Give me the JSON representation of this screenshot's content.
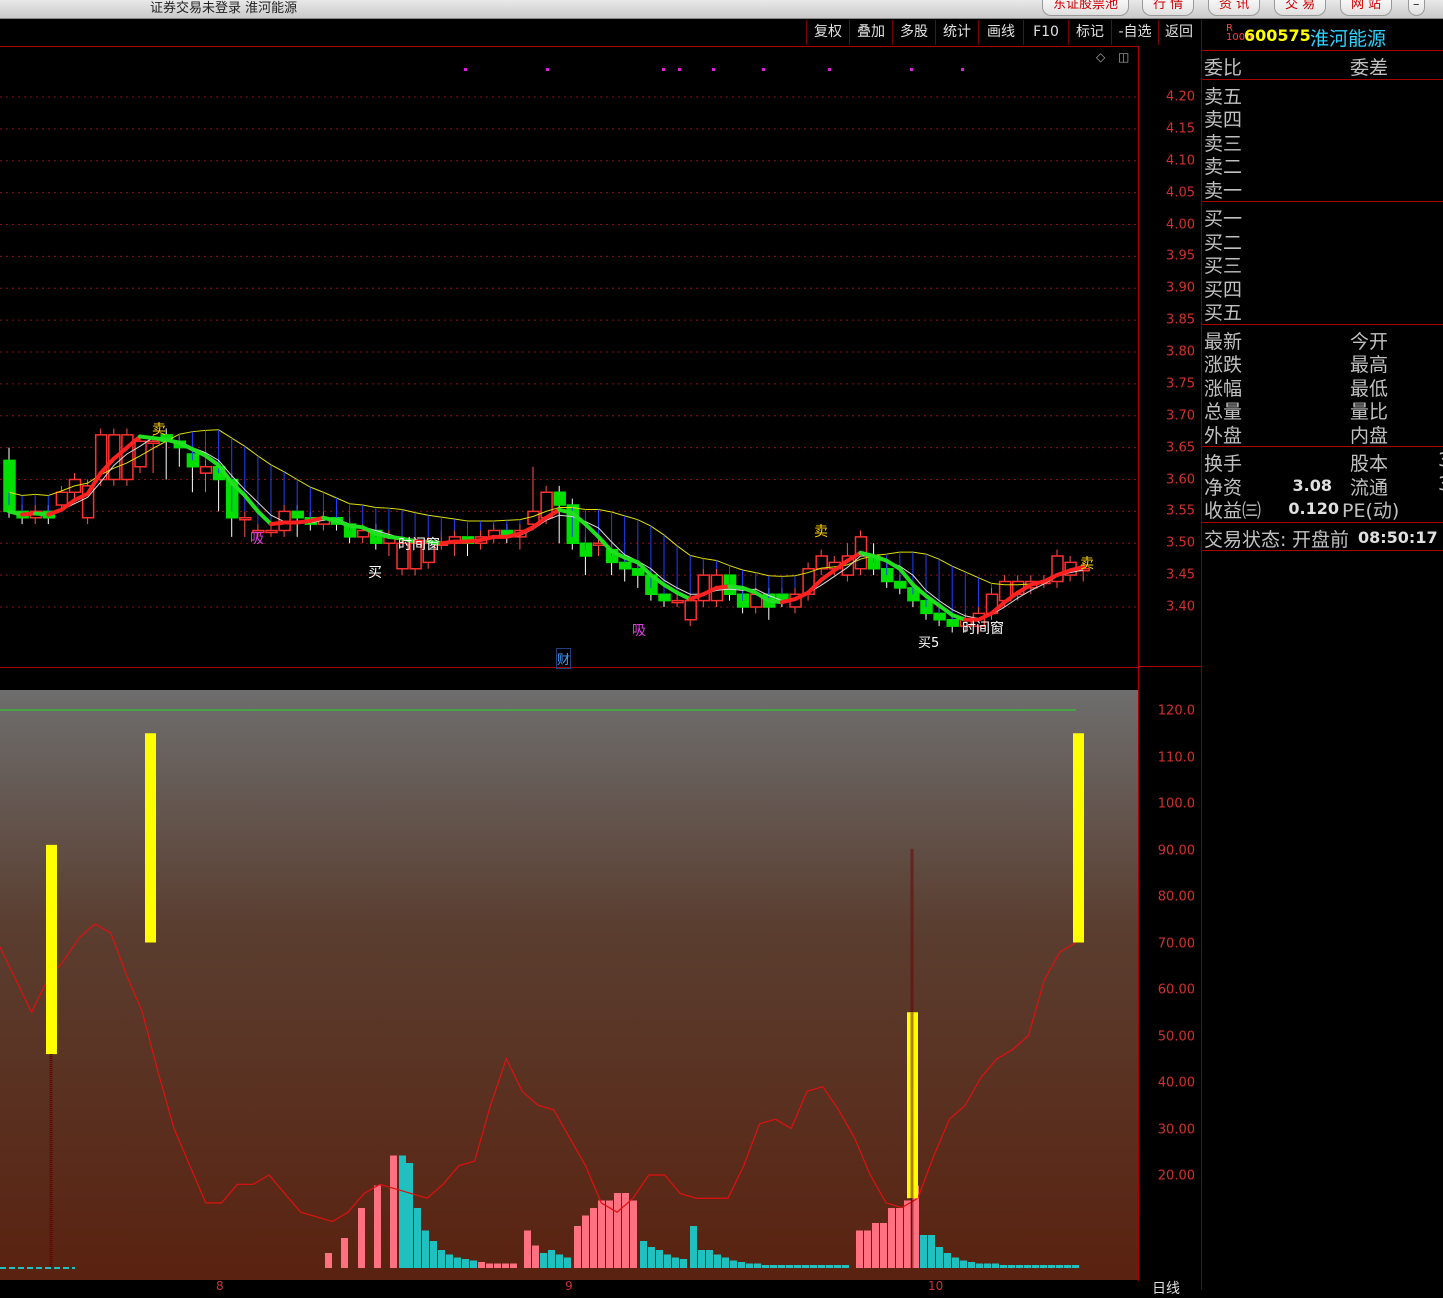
{
  "window": {
    "title": "证券交易未登录  淮河能源",
    "top_buttons": [
      "东证股票池",
      "行 情",
      "资 讯",
      "交 易",
      "网 站"
    ]
  },
  "toolbar": {
    "buttons": [
      "复权",
      "叠加",
      "多股",
      "统计",
      "画线",
      "F10",
      "标记",
      "-自选",
      "返回"
    ]
  },
  "quote": {
    "code": "600575",
    "name": "淮河能源",
    "badge_top": "R",
    "badge_bottom": "1000",
    "order_labels": {
      "left": "委比",
      "right": "委差"
    },
    "sell_levels": [
      "卖五",
      "卖四",
      "卖三",
      "卖二",
      "卖一"
    ],
    "buy_levels": [
      "买一",
      "买二",
      "买三",
      "买四",
      "买五"
    ],
    "stats": [
      {
        "left": "最新",
        "right": "今开"
      },
      {
        "left": "涨跌",
        "right": "最高"
      },
      {
        "left": "涨幅",
        "right": "最低"
      },
      {
        "left": "总量",
        "right": "量比"
      },
      {
        "left": "外盘",
        "right": "内盘"
      }
    ],
    "fundamentals": [
      {
        "left": "换手",
        "value": "",
        "right": "股本",
        "rval": "3"
      },
      {
        "left": "净资",
        "value": "3.08",
        "right": "流通",
        "rval": "3"
      },
      {
        "left": "收益㈢",
        "value": "0.120",
        "right": "PE(动)",
        "rval": ""
      }
    ],
    "trade_status_label": "交易状态:",
    "trade_status": "开盘前",
    "time": "08:50:17"
  },
  "price_axis": {
    "ticks": [
      "4.20",
      "4.15",
      "4.10",
      "4.05",
      "4.00",
      "3.95",
      "3.90",
      "3.85",
      "3.80",
      "3.75",
      "3.70",
      "3.65",
      "3.60",
      "3.55",
      "3.50",
      "3.45",
      "3.40"
    ]
  },
  "indicator_axis": {
    "ticks": [
      "120.0",
      "110.0",
      "100.0",
      "90.00",
      "80.00",
      "70.00",
      "60.00",
      "50.00",
      "40.00",
      "30.00",
      "20.00"
    ]
  },
  "date_labels": [
    "8",
    "9",
    "10"
  ],
  "period_label": "日线",
  "annotations": {
    "sell": "卖",
    "buy": "买",
    "absorb": "吸",
    "time_window": "时间窗",
    "finance": "财",
    "buy5": "买5"
  },
  "colors": {
    "up": "#ff3030",
    "down": "#00e000",
    "ma_yellow": "#e0e000",
    "axis_red": "#d03030",
    "signal_yellow": "#ffff00",
    "cyan_bar": "#20c0c0",
    "pink_bar": "#ff7080"
  },
  "chart_data": {
    "type": "candlestick",
    "price_range": [
      3.38,
      4.21
    ],
    "candles": [
      [
        3.63,
        3.55,
        3.65,
        3.54
      ],
      [
        3.55,
        3.54,
        3.56,
        3.53
      ],
      [
        3.54,
        3.55,
        3.56,
        3.53
      ],
      [
        3.55,
        3.54,
        3.56,
        3.53
      ],
      [
        3.56,
        3.58,
        3.59,
        3.55
      ],
      [
        3.58,
        3.6,
        3.61,
        3.57
      ],
      [
        3.54,
        3.59,
        3.6,
        3.53
      ],
      [
        3.6,
        3.67,
        3.68,
        3.59
      ],
      [
        3.6,
        3.67,
        3.68,
        3.59
      ],
      [
        3.6,
        3.67,
        3.68,
        3.59
      ],
      [
        3.62,
        3.66,
        3.67,
        3.61
      ],
      [
        3.66,
        3.66,
        3.67,
        3.61
      ],
      [
        3.67,
        3.66,
        3.68,
        3.6
      ],
      [
        3.66,
        3.65,
        3.67,
        3.62
      ],
      [
        3.64,
        3.62,
        3.65,
        3.58
      ],
      [
        3.61,
        3.62,
        3.64,
        3.58
      ],
      [
        3.62,
        3.6,
        3.63,
        3.55
      ],
      [
        3.6,
        3.54,
        3.61,
        3.51
      ],
      [
        3.54,
        3.54,
        3.55,
        3.51
      ],
      [
        3.52,
        3.52,
        3.53,
        3.51
      ],
      [
        3.52,
        3.52,
        3.54,
        3.51
      ],
      [
        3.52,
        3.55,
        3.56,
        3.51
      ],
      [
        3.55,
        3.54,
        3.56,
        3.51
      ],
      [
        3.54,
        3.53,
        3.55,
        3.52
      ],
      [
        3.53,
        3.54,
        3.55,
        3.52
      ],
      [
        3.54,
        3.53,
        3.56,
        3.52
      ],
      [
        3.53,
        3.51,
        3.54,
        3.5
      ],
      [
        3.51,
        3.52,
        3.53,
        3.5
      ],
      [
        3.52,
        3.5,
        3.53,
        3.49
      ],
      [
        3.5,
        3.51,
        3.52,
        3.48
      ],
      [
        3.46,
        3.5,
        3.51,
        3.45
      ],
      [
        3.46,
        3.5,
        3.51,
        3.45
      ],
      [
        3.47,
        3.5,
        3.51,
        3.46
      ],
      [
        3.5,
        3.5,
        3.52,
        3.49
      ],
      [
        3.5,
        3.51,
        3.52,
        3.48
      ],
      [
        3.51,
        3.5,
        3.52,
        3.48
      ],
      [
        3.5,
        3.51,
        3.53,
        3.49
      ],
      [
        3.51,
        3.52,
        3.53,
        3.5
      ],
      [
        3.52,
        3.51,
        3.53,
        3.5
      ],
      [
        3.51,
        3.52,
        3.53,
        3.49
      ],
      [
        3.53,
        3.55,
        3.62,
        3.52
      ],
      [
        3.54,
        3.58,
        3.59,
        3.53
      ],
      [
        3.58,
        3.56,
        3.59,
        3.5
      ],
      [
        3.56,
        3.5,
        3.57,
        3.49
      ],
      [
        3.5,
        3.48,
        3.51,
        3.45
      ],
      [
        3.5,
        3.5,
        3.52,
        3.48
      ],
      [
        3.49,
        3.47,
        3.5,
        3.45
      ],
      [
        3.47,
        3.46,
        3.48,
        3.44
      ],
      [
        3.46,
        3.45,
        3.47,
        3.43
      ],
      [
        3.45,
        3.42,
        3.46,
        3.41
      ],
      [
        3.42,
        3.41,
        3.43,
        3.4
      ],
      [
        3.41,
        3.41,
        3.42,
        3.4
      ],
      [
        3.38,
        3.41,
        3.42,
        3.37
      ],
      [
        3.41,
        3.45,
        3.46,
        3.4
      ],
      [
        3.41,
        3.45,
        3.46,
        3.4
      ],
      [
        3.45,
        3.42,
        3.46,
        3.41
      ],
      [
        3.42,
        3.4,
        3.43,
        3.39
      ],
      [
        3.4,
        3.42,
        3.43,
        3.39
      ],
      [
        3.42,
        3.4,
        3.43,
        3.38
      ],
      [
        3.42,
        3.41,
        3.43,
        3.4
      ],
      [
        3.4,
        3.42,
        3.43,
        3.39
      ],
      [
        3.42,
        3.46,
        3.47,
        3.41
      ],
      [
        3.46,
        3.48,
        3.49,
        3.45
      ],
      [
        3.46,
        3.47,
        3.48,
        3.45
      ],
      [
        3.45,
        3.48,
        3.5,
        3.44
      ],
      [
        3.46,
        3.51,
        3.52,
        3.45
      ],
      [
        3.48,
        3.46,
        3.5,
        3.45
      ],
      [
        3.46,
        3.44,
        3.47,
        3.43
      ],
      [
        3.44,
        3.43,
        3.45,
        3.42
      ],
      [
        3.43,
        3.41,
        3.44,
        3.4
      ],
      [
        3.41,
        3.39,
        3.42,
        3.38
      ],
      [
        3.39,
        3.38,
        3.4,
        3.37
      ],
      [
        3.38,
        3.37,
        3.39,
        3.36
      ],
      [
        3.37,
        3.38,
        3.39,
        3.36
      ],
      [
        3.37,
        3.39,
        3.4,
        3.36
      ],
      [
        3.39,
        3.42,
        3.43,
        3.38
      ],
      [
        3.41,
        3.44,
        3.45,
        3.4
      ],
      [
        3.42,
        3.44,
        3.45,
        3.41
      ],
      [
        3.43,
        3.44,
        3.45,
        3.42
      ],
      [
        3.44,
        3.44,
        3.45,
        3.43
      ],
      [
        3.44,
        3.48,
        3.49,
        3.43
      ],
      [
        3.45,
        3.47,
        3.48,
        3.44
      ],
      [
        3.46,
        3.46,
        3.47,
        3.44
      ]
    ],
    "indicator": {
      "line": [
        69,
        62,
        55,
        62,
        66,
        71,
        74,
        72,
        63,
        55,
        42,
        30,
        22,
        14,
        14,
        18,
        18,
        20,
        16,
        12,
        11,
        10,
        12,
        16,
        18,
        17,
        16,
        15,
        18,
        22,
        23,
        35,
        45,
        38,
        35,
        34,
        28,
        22,
        14,
        12,
        15,
        20,
        20,
        16,
        15,
        15,
        15,
        22,
        31,
        32,
        30,
        38,
        39,
        34,
        28,
        20,
        14,
        13,
        15,
        24,
        32,
        35,
        41,
        45,
        47,
        50,
        62,
        68,
        70
      ],
      "signal_bars": [
        [
          46,
          91
        ],
        [
          70,
          115
        ],
        [
          15,
          55
        ],
        [
          70,
          115
        ]
      ]
    }
  }
}
